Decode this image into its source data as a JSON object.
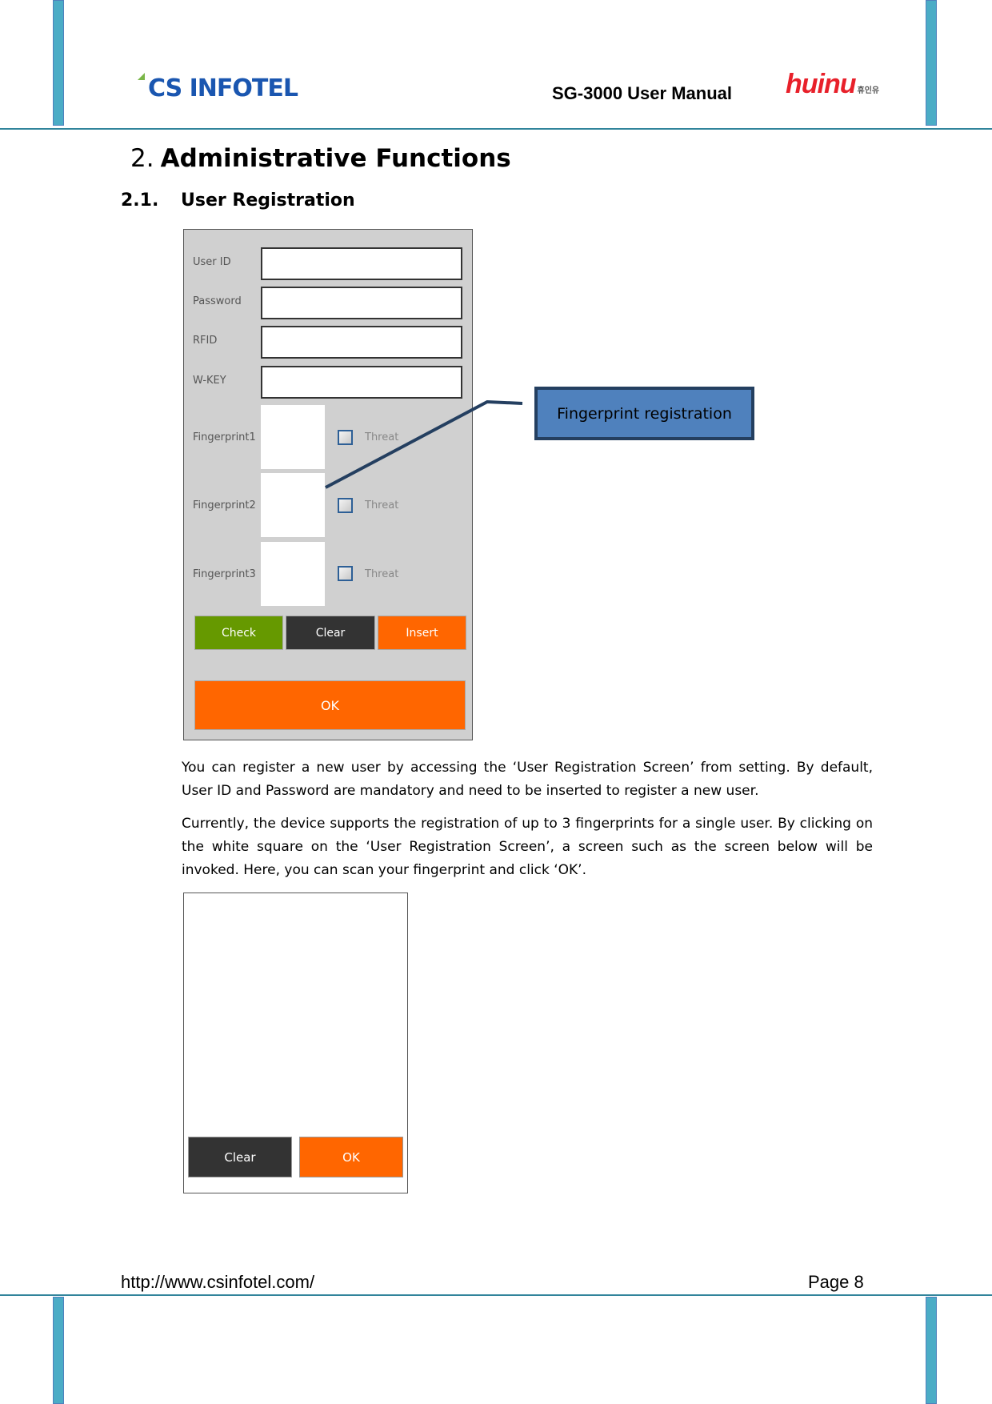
{
  "header": {
    "company_logo": "CS INFOTEL",
    "manual_title": "SG-3000 User Manual",
    "partner_logo": "huinu",
    "partner_logo_korean": "휴인유"
  },
  "section": {
    "number": "2.",
    "title": "Administrative Functions"
  },
  "subsection": {
    "number": "2.1.",
    "title": "User Registration"
  },
  "registration_screen": {
    "fields": [
      {
        "label": "User ID",
        "value": ""
      },
      {
        "label": "Password",
        "value": ""
      },
      {
        "label": "RFID",
        "value": ""
      },
      {
        "label": "W-KEY",
        "value": ""
      }
    ],
    "fingerprints": [
      {
        "label": "Fingerprint1",
        "checkbox_label": "Threat",
        "checked": false
      },
      {
        "label": "Fingerprint2",
        "checkbox_label": "Threat",
        "checked": false
      },
      {
        "label": "Fingerprint3",
        "checkbox_label": "Threat",
        "checked": false
      }
    ],
    "buttons": {
      "check": "Check",
      "clear": "Clear",
      "insert": "Insert",
      "ok": "OK"
    }
  },
  "callout": {
    "label": "Fingerprint registration"
  },
  "paragraphs": [
    "You can register a new user by accessing the ‘User Registration Screen’ from setting. By default, User ID and Password are mandatory and need to be inserted to register a new user.",
    "Currently, the device supports the registration of up to 3 fingerprints for a single user. By clicking on the white square on the ‘User Registration Screen’, a screen such as the screen below will be invoked. Here, you can scan your fingerprint and click ‘OK’."
  ],
  "scan_screen": {
    "buttons": {
      "clear": "Clear",
      "ok": "OK"
    }
  },
  "footer": {
    "url": "http://www.csinfotel.com/",
    "page_label": "Page 8"
  },
  "colors": {
    "accent_bar": "#4bacc6",
    "rule": "#31849b",
    "check_green": "#669900",
    "clear_dark": "#333333",
    "action_orange": "#ff6600",
    "callout_fill": "#4f81bd",
    "callout_border": "#243f60"
  }
}
